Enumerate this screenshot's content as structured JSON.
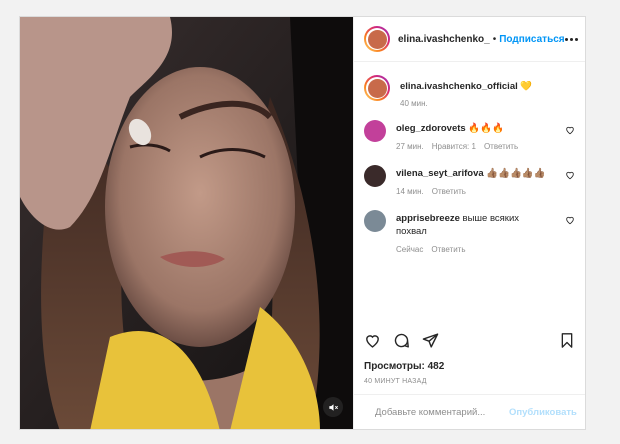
{
  "post": {
    "author": "elina.ivashchenko_official",
    "header_author": "elina.ivashchenko_",
    "header_separator": "•",
    "follow_label": "Подписаться",
    "caption_emoji": "💛",
    "caption_time": "40 мин."
  },
  "comments": [
    {
      "user": "oleg_zdorovets",
      "text": "🔥🔥🔥",
      "time": "27 мин.",
      "likes": "Нравится: 1",
      "reply": "Ответить",
      "avatar_color": "#c2409a"
    },
    {
      "user": "vilena_seyt_arifova",
      "text": "👍🏽👍🏽👍🏽👍🏽👍🏽",
      "time": "14 мин.",
      "reply": "Ответить",
      "avatar_color": "#3a2a2a"
    },
    {
      "user": "apprisebreeze",
      "text": "выше всяких похвал",
      "time": "Сейчас",
      "reply": "Ответить",
      "avatar_color": "#7b8a96"
    }
  ],
  "stats": {
    "views": "Просмотры: 482",
    "posted_ago": "40 МИНУТ НАЗАД"
  },
  "composer": {
    "placeholder": "Добавьте комментарий...",
    "publish_label": "Опубликовать"
  },
  "icons": {
    "header_avatar": "story-ring-avatar",
    "more": "more-horizontal-icon",
    "like": "heart-icon",
    "comment": "comment-icon",
    "share": "paper-plane-icon",
    "save": "bookmark-icon",
    "emoji": "smiley-icon",
    "mute": "speaker-muted-icon"
  },
  "colors": {
    "link": "#0095f6",
    "publish_disabled": "#b2dffc",
    "secondary_text": "#8e8e8e",
    "border": "#dbdbdb"
  }
}
